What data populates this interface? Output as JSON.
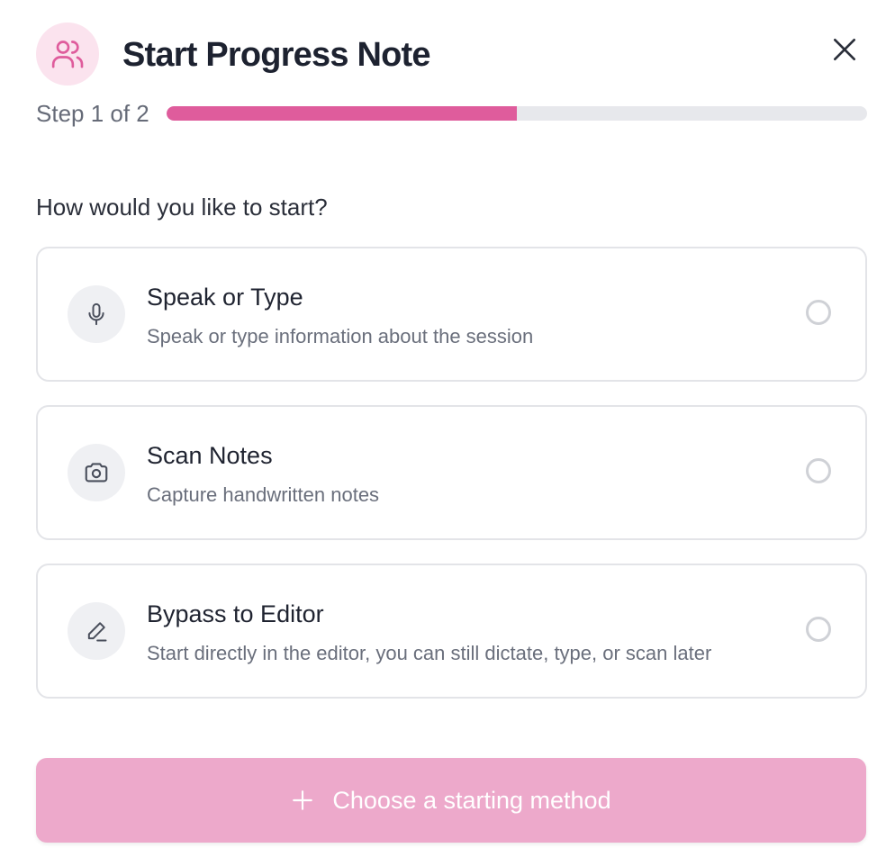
{
  "header": {
    "title": "Start Progress Note",
    "icon": "users-icon",
    "accent_color": "#df5c9c",
    "icon_bg": "#fbe3ee",
    "close_icon": "close-icon"
  },
  "progress": {
    "step_label": "Step 1 of 2",
    "current_step": 1,
    "total_steps": 2,
    "fill_fraction": 0.5
  },
  "question": "How would you like to start?",
  "options": [
    {
      "title": "Speak or Type",
      "description": "Speak or type information about the session",
      "icon": "microphone-icon",
      "selected": false
    },
    {
      "title": "Scan Notes",
      "description": "Capture handwritten notes",
      "icon": "camera-icon",
      "selected": false
    },
    {
      "title": "Bypass to Editor",
      "description": "Start directly in the editor, you can still dictate, type, or scan later",
      "icon": "pencil-icon",
      "selected": false
    }
  ],
  "primary_button": {
    "label": "Choose a starting method",
    "icon": "plus-icon",
    "disabled": true,
    "color": "#eda9cb"
  }
}
